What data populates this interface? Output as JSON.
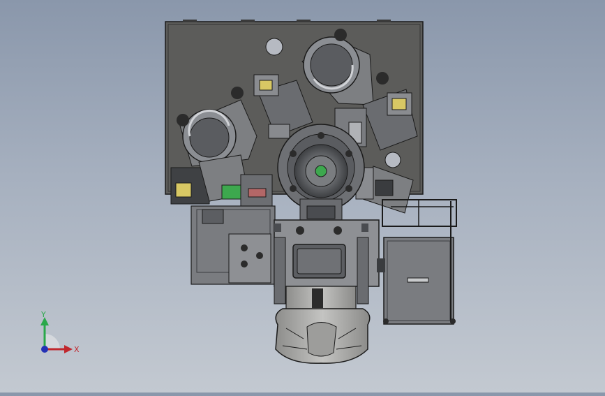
{
  "viewport": {
    "background_top": "#8a97ab",
    "background_bottom": "#c3c9d1"
  },
  "model": {
    "body_color": "#5c5c5a",
    "metal_color": "#6e6e72",
    "light_metal": "#b9bcc0",
    "motor_color": "#a7a7a5",
    "edge_color": "#1a1a1a",
    "accent_yellow": "#d8c864",
    "accent_green": "#3da84e"
  },
  "triad": {
    "x_label": "X",
    "y_label": "Y",
    "x_color": "#c0272d",
    "y_color": "#2aa84a",
    "z_color": "#2431b5"
  }
}
